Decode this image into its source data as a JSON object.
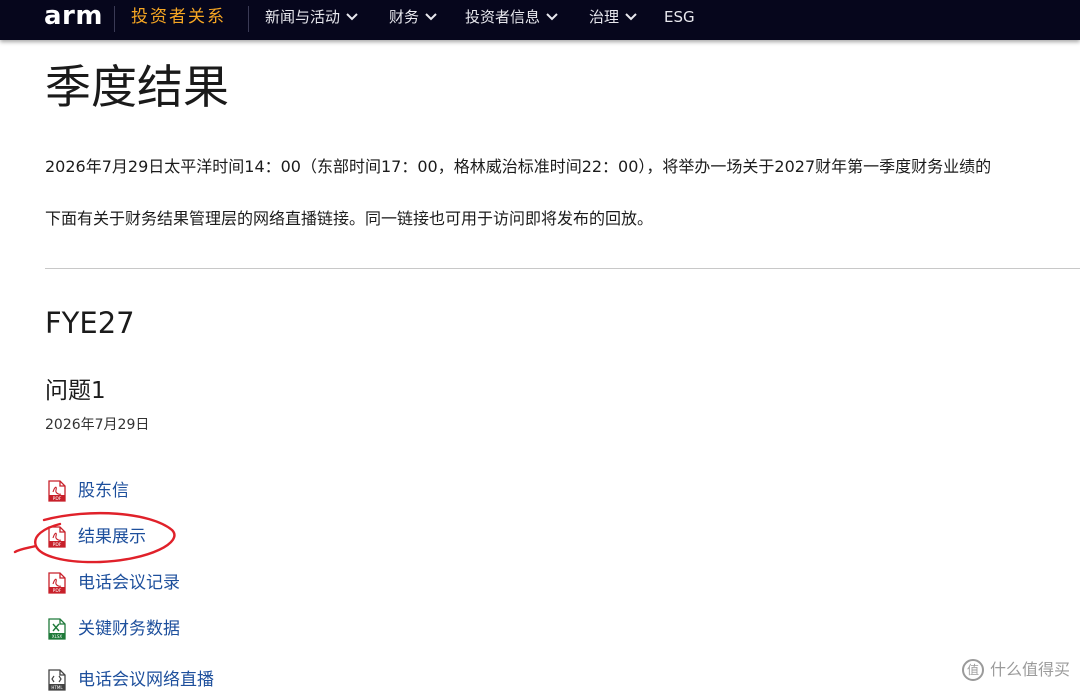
{
  "nav": {
    "logo": "arm",
    "section": "投资者关系",
    "items": [
      {
        "label": "新闻与活动",
        "dropdown": true
      },
      {
        "label": "财务",
        "dropdown": true
      },
      {
        "label": "投资者信息",
        "dropdown": true
      },
      {
        "label": "治理",
        "dropdown": true
      },
      {
        "label": "ESG",
        "dropdown": false
      }
    ]
  },
  "page": {
    "title": "季度结果",
    "intro": "2026年7月29日太平洋时间14：00（东部时间17：00，格林威治标准时间22：00），将举办一场关于2027财年第一季度财务业绩的",
    "intro2": "下面有关于财务结果管理层的网络直播链接。同一链接也可用于访问即将发布的回放。"
  },
  "results": {
    "fiscal_year": "FYE27",
    "issue_title": "问题1",
    "issue_date": "2026年7月29日",
    "documents": [
      {
        "label": "股东信",
        "icon": "pdf-icon"
      },
      {
        "label": "结果展示",
        "icon": "pdf-icon"
      },
      {
        "label": "电话会议记录",
        "icon": "pdf-icon"
      },
      {
        "label": "关键财务数据",
        "icon": "xlsx-icon"
      },
      {
        "label": "电话会议网络直播",
        "icon": "html-icon"
      }
    ]
  },
  "watermark": {
    "icon_text": "值",
    "text": "什么值得买"
  },
  "colors": {
    "nav_bg": "#06061c",
    "nav_section": "#f6a623",
    "link": "#1d4f9c",
    "pdf_red": "#c8202a",
    "xlsx_green": "#1f7a3a",
    "annotation_red": "#e0212a"
  }
}
